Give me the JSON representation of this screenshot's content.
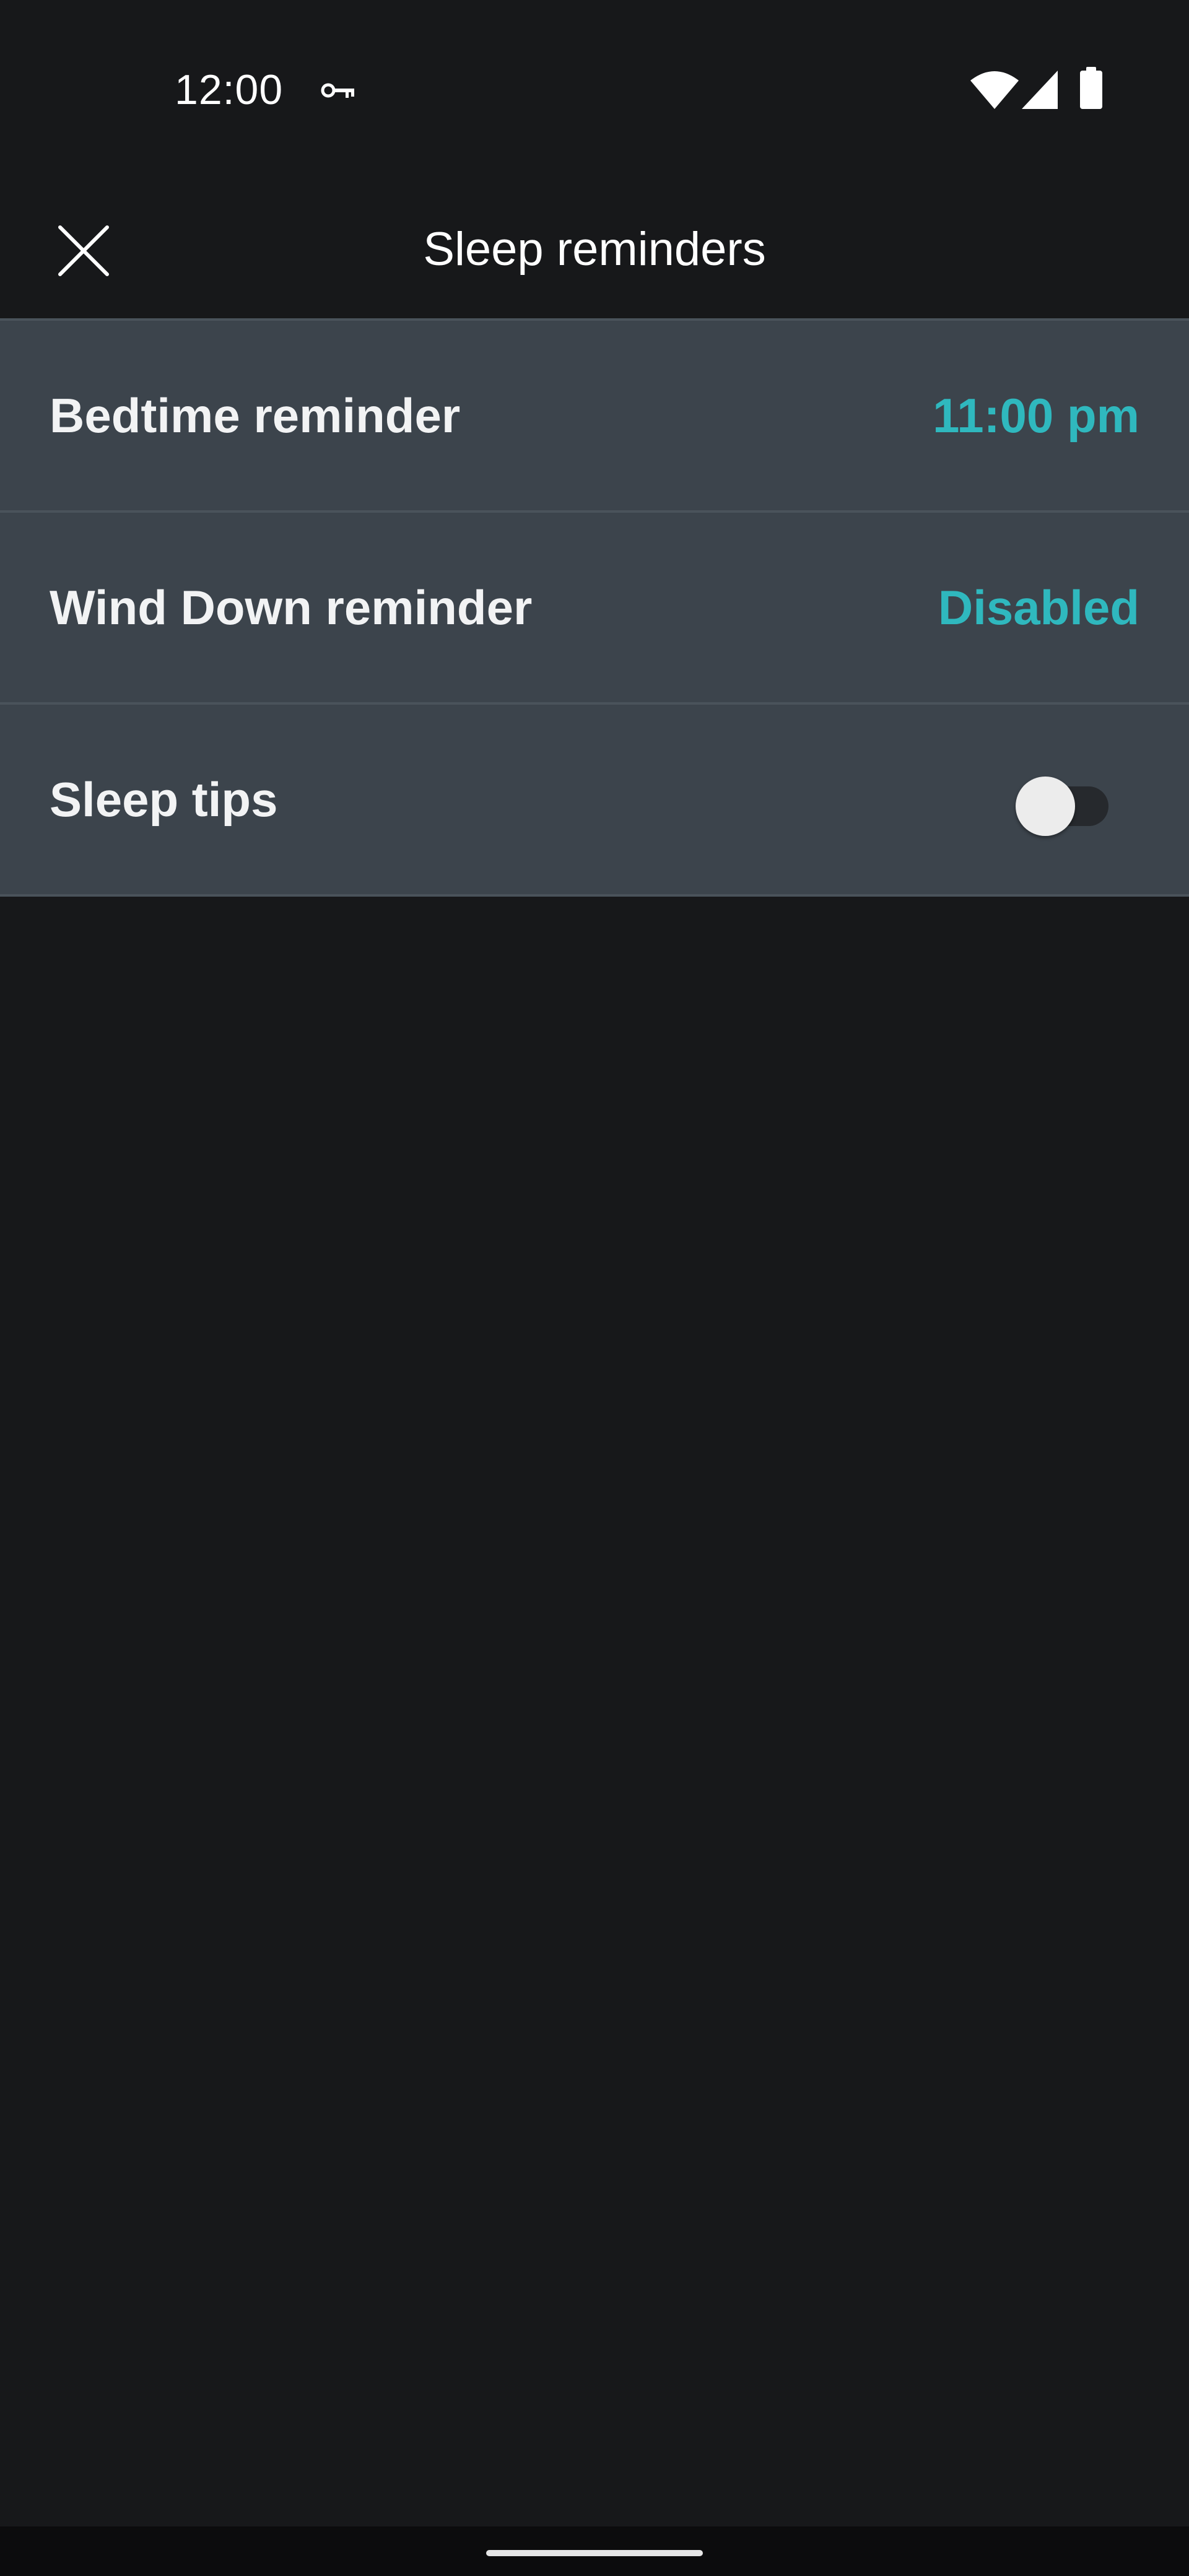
{
  "status_bar": {
    "time": "12:00",
    "icons": [
      "key-icon",
      "wifi-icon",
      "signal-icon",
      "battery-icon"
    ]
  },
  "app_bar": {
    "title": "Sleep reminders",
    "close_icon": "close-icon"
  },
  "settings": [
    {
      "label": "Bedtime reminder",
      "value": "11:00 pm"
    },
    {
      "label": "Wind Down reminder",
      "value": "Disabled"
    },
    {
      "label": "Sleep tips",
      "toggle_on": false
    }
  ],
  "colors": {
    "background": "#17181a",
    "row_background": "#3c444c",
    "accent": "#2fb8be",
    "divider": "#4a535b"
  }
}
